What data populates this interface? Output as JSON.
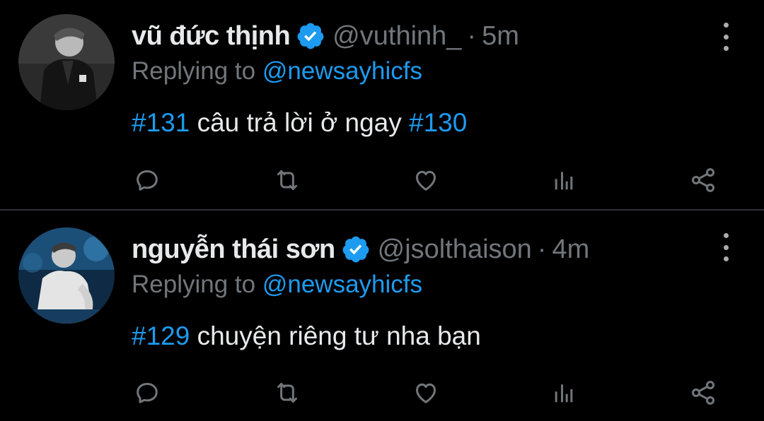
{
  "tweets": [
    {
      "name": "vũ đức thịnh",
      "handle": "@vuthinh_",
      "separator": "·",
      "time": "5m",
      "replying_label": "Replying to",
      "replying_to": "@newsayhicfs",
      "hashtag_start": "#131",
      "text": "câu trả lời ở ngay",
      "hashtag_end": "#130",
      "avatar_icon": "user-avatar-bw-suit",
      "verified_icon": "verified-badge-icon"
    },
    {
      "name": "nguyễn thái sơn",
      "handle": "@jsolthaison",
      "separator": "·",
      "time": "4m",
      "replying_label": "Replying to",
      "replying_to": "@newsayhicfs",
      "hashtag_start": "#129",
      "text": "chuyện riêng tư nha bạn",
      "hashtag_end": "",
      "avatar_icon": "user-avatar-blue-stage",
      "verified_icon": "verified-badge-icon"
    }
  ],
  "action_icons": [
    "reply-icon",
    "retweet-icon",
    "like-icon",
    "analytics-icon",
    "share-icon"
  ],
  "colors": {
    "background": "#000000",
    "text": "#e7e9ea",
    "muted": "#71767b",
    "accent": "#1d9bf0",
    "divider": "#2f3336"
  }
}
